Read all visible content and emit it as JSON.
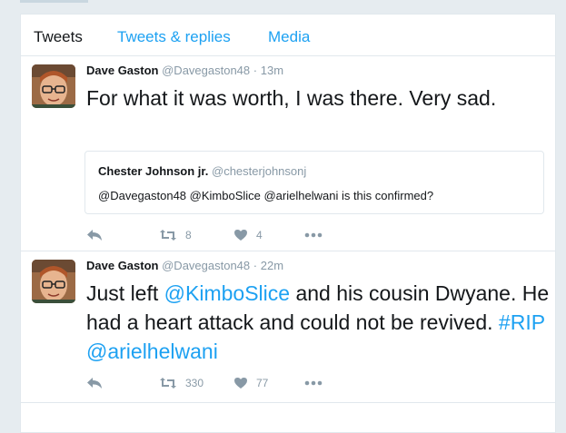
{
  "tabs": [
    {
      "label": "Tweets",
      "active": true
    },
    {
      "label": "Tweets & replies",
      "active": false
    },
    {
      "label": "Media",
      "active": false
    }
  ],
  "colors": {
    "accent": "#1da1f2",
    "muted": "#8899a6",
    "text": "#14171a",
    "border": "#e1e8ed",
    "background": "#e6ecf0"
  },
  "tweets": [
    {
      "name": "Dave Gaston",
      "handle": "@Davegaston48",
      "separator": "·",
      "time": "13m",
      "text": "For what it was worth, I was there.  Very sad.",
      "quote": {
        "name": "Chester Johnson jr.",
        "handle": "@chesterjohnsonj",
        "text": "@Davegaston48 @KimboSlice @arielhelwani is this confirmed?"
      },
      "actions": {
        "reply_icon": "reply-icon",
        "retweet_icon": "retweet-icon",
        "retweets": "8",
        "like_icon": "heart-icon",
        "likes": "4",
        "more_icon": "more-icon"
      }
    },
    {
      "name": "Dave Gaston",
      "handle": "@Davegaston48",
      "separator": "·",
      "time": "22m",
      "text_parts": [
        "Just left ",
        "@KimboSlice",
        " and his cousin Dwyane.  He had a heart attack and could not be revived.  ",
        "#RIP",
        " ",
        "@arielhelwani"
      ],
      "actions": {
        "reply_icon": "reply-icon",
        "retweet_icon": "retweet-icon",
        "retweets": "330",
        "like_icon": "heart-icon",
        "likes": "77",
        "more_icon": "more-icon"
      }
    }
  ]
}
